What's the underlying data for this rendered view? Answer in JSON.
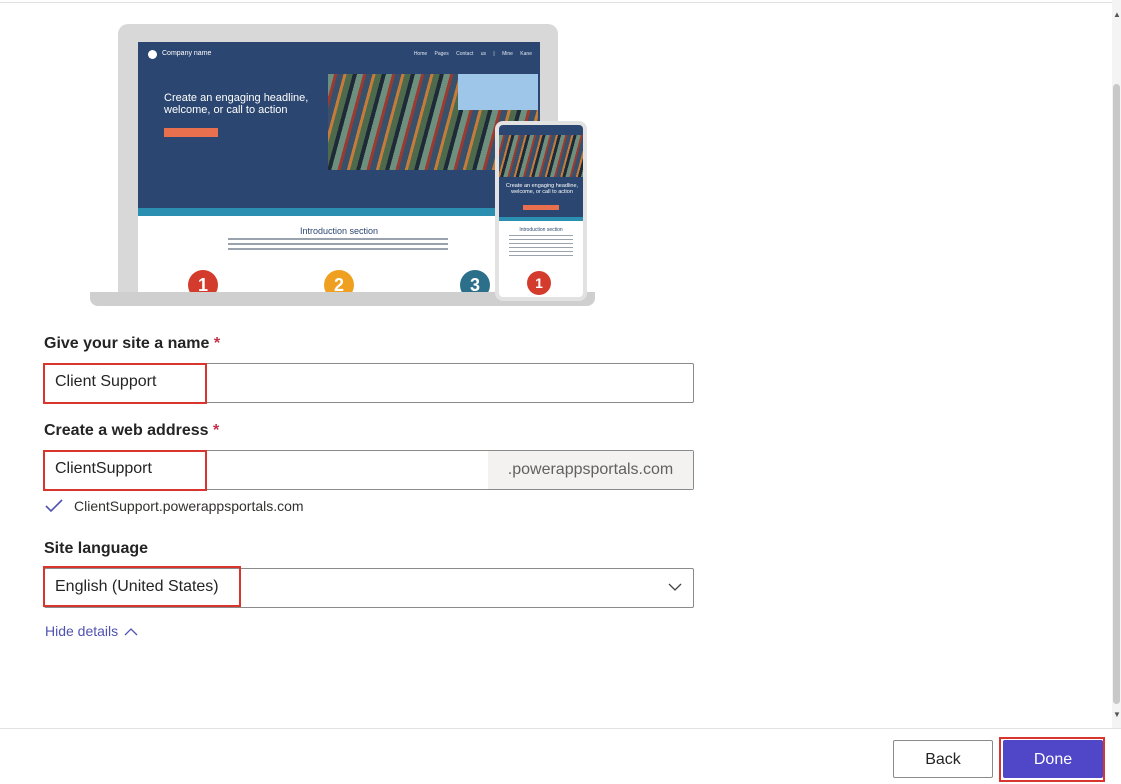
{
  "preview": {
    "company": "Company name",
    "nav_links": "Home Pages Contact us | Mine Kane",
    "headline": "Create an engaging headline, welcome, or call to action",
    "intro_title": "Introduction section",
    "numbers": [
      "1",
      "2",
      "3"
    ],
    "mobile_headline": "Create an engaging headline, welcome, or call to action",
    "mobile_intro_title": "Introduction section",
    "mobile_number": "1"
  },
  "form": {
    "site_name": {
      "label": "Give your site a name",
      "required_mark": "*",
      "value": "Client Support"
    },
    "web_address": {
      "label": "Create a web address",
      "required_mark": "*",
      "value": "ClientSupport",
      "suffix": ".powerappsportals.com",
      "validation_text": "ClientSupport.powerappsportals.com"
    },
    "language": {
      "label": "Site language",
      "value": "English (United States)"
    },
    "hide_details": "Hide details"
  },
  "footer": {
    "back_label": "Back",
    "done_label": "Done"
  },
  "colors": {
    "accent": "#4f46c8",
    "highlight": "#d9352f",
    "link": "#4f52b2",
    "required": "#c4314b"
  }
}
